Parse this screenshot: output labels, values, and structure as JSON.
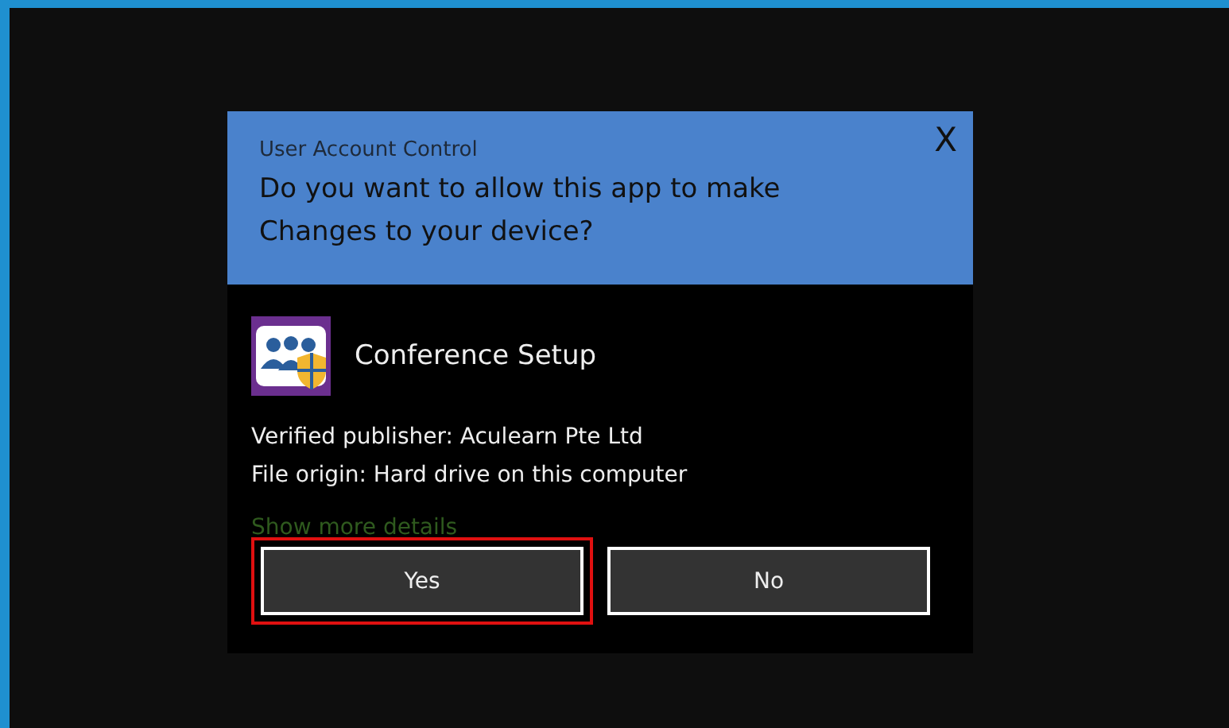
{
  "dialog": {
    "title": "User Account Control",
    "close": "X",
    "question": "Do you want to allow this app to make Changes to your device?",
    "app_name": "Conference Setup",
    "details": [
      "Verified publisher: Aculearn Pte Ltd",
      "File origin: Hard drive on this computer"
    ],
    "more_link": "Show more details",
    "buttons": [
      {
        "label": "Yes",
        "highlighted": true
      },
      {
        "label": "No",
        "highlighted": false
      }
    ]
  }
}
